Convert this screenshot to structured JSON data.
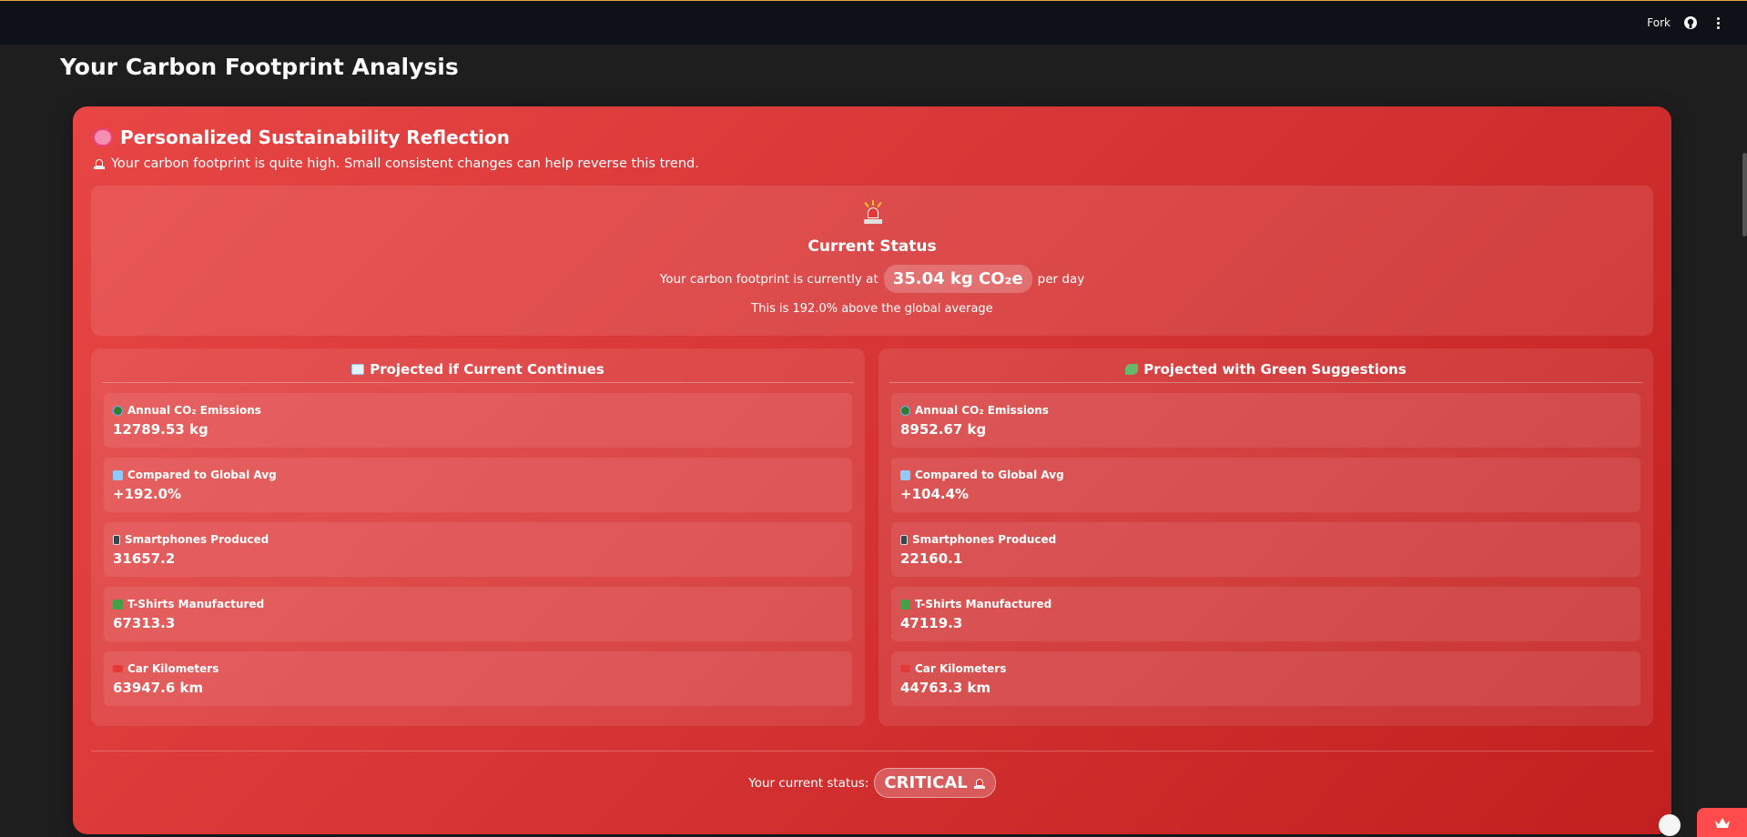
{
  "topbar": {
    "fork_label": "Fork",
    "github_icon": "github-icon",
    "menu_icon": "kebab-menu-icon"
  },
  "page_title": "Your Carbon Footprint Analysis",
  "reflection": {
    "title": "Personalized Sustainability Reflection",
    "title_icon": "brain-icon",
    "message": "Your carbon footprint is quite high. Small consistent changes can help reverse this trend.",
    "message_icon": "siren-icon"
  },
  "status": {
    "icon": "siren-icon",
    "title": "Current Status",
    "line_prefix": "Your carbon footprint is currently at",
    "value": "35.04 kg CO₂e",
    "line_suffix": "per day",
    "avg_line": "This is 192.0% above the global average"
  },
  "projections": {
    "current": {
      "title": "Projected if Current Continues",
      "title_icon": "chart-increasing-icon",
      "metrics": [
        {
          "icon": "globe-icon",
          "label": "Annual CO₂ Emissions",
          "value": "12789.53 kg"
        },
        {
          "icon": "bar-chart-icon",
          "label": "Compared to Global Avg",
          "value": "+192.0%"
        },
        {
          "icon": "phone-icon",
          "label": "Smartphones Produced",
          "value": "31657.2"
        },
        {
          "icon": "tshirt-icon",
          "label": "T-Shirts Manufactured",
          "value": "67313.3"
        },
        {
          "icon": "car-icon",
          "label": "Car Kilometers",
          "value": "63947.6 km"
        }
      ]
    },
    "green": {
      "title": "Projected with Green Suggestions",
      "title_icon": "herb-icon",
      "metrics": [
        {
          "icon": "globe-icon",
          "label": "Annual CO₂ Emissions",
          "value": "8952.67 kg"
        },
        {
          "icon": "bar-chart-icon",
          "label": "Compared to Global Avg",
          "value": "+104.4%"
        },
        {
          "icon": "phone-icon",
          "label": "Smartphones Produced",
          "value": "22160.1"
        },
        {
          "icon": "tshirt-icon",
          "label": "T-Shirts Manufactured",
          "value": "47119.3"
        },
        {
          "icon": "car-icon",
          "label": "Car Kilometers",
          "value": "44763.3 km"
        }
      ]
    }
  },
  "current_status": {
    "label": "Your current status:",
    "value": "CRITICAL",
    "icon": "siren-icon"
  },
  "colors": {
    "card_start": "#e84545",
    "card_end": "#c21f1f",
    "topbar": "#0e1117",
    "background": "#1e1e1e",
    "accent": "#ff4b4b"
  }
}
